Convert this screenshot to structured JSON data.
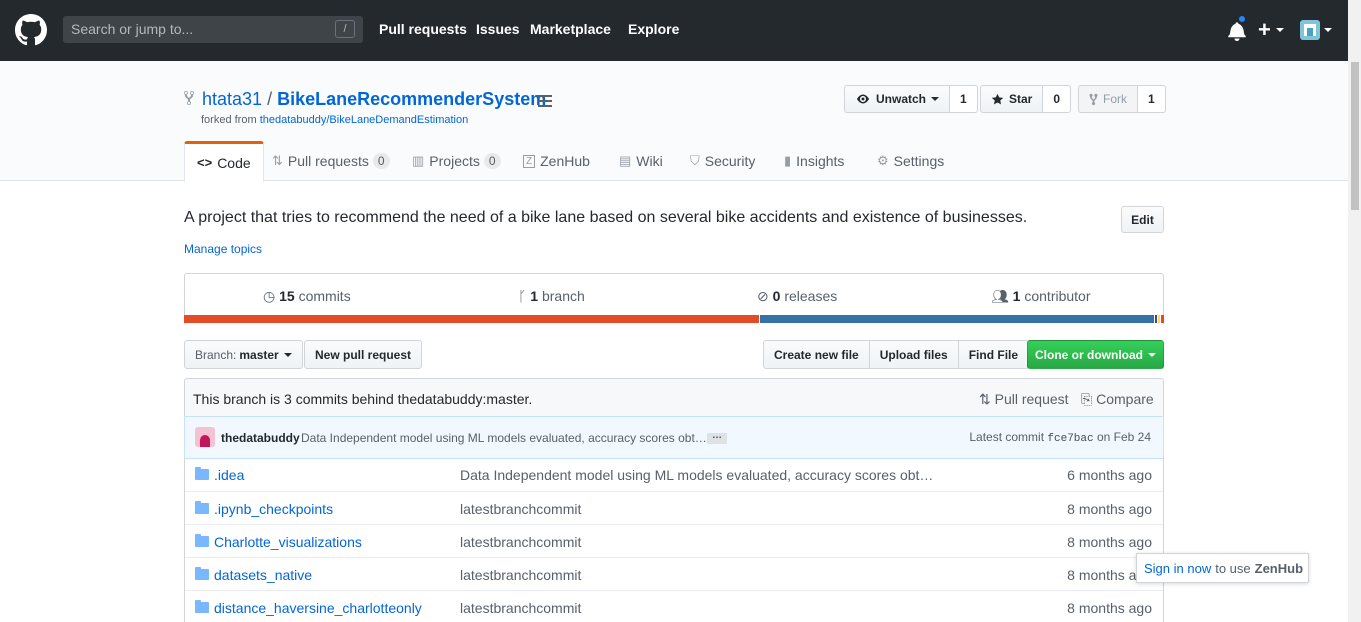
{
  "header": {
    "search_placeholder": "Search or jump to...",
    "search_shortcut": "/",
    "nav": [
      "Pull requests",
      "Issues",
      "Marketplace",
      "Explore"
    ],
    "plus": "+"
  },
  "repo": {
    "owner": "htata31",
    "separator": "/",
    "name": "BikeLaneRecommenderSystem",
    "forked_label": "forked from",
    "forked_from": "thedatabuddy/BikeLaneDemandEstimation",
    "unwatch_label": "Unwatch",
    "watch_count": "1",
    "star_label": "Star",
    "star_count": "0",
    "fork_label": "Fork",
    "fork_count": "1"
  },
  "tabs": {
    "code": "Code",
    "pulls": "Pull requests",
    "pulls_count": "0",
    "projects": "Projects",
    "projects_count": "0",
    "zenhub": "ZenHub",
    "wiki": "Wiki",
    "security": "Security",
    "insights": "Insights",
    "settings": "Settings"
  },
  "description": {
    "text": "A project that tries to recommend the need of a bike lane based on several bike accidents and existence of businesses.",
    "edit": "Edit",
    "manage_topics": "Manage topics"
  },
  "summary": {
    "commits_num": "15",
    "commits_label": "commits",
    "branch_num": "1",
    "branch_label": "branch",
    "releases_num": "0",
    "releases_label": "releases",
    "contributors_num": "1",
    "contributors_label": "contributor"
  },
  "languages": [
    {
      "color": "#e34c26",
      "fraction": 0.589
    },
    {
      "color": "#3572a5",
      "fraction": 0.404
    },
    {
      "color": "#563d7c",
      "fraction": 0.002
    },
    {
      "color": "#f1e05a",
      "fraction": 0.002
    },
    {
      "color": "#e44b23",
      "fraction": 0.003
    }
  ],
  "file_nav": {
    "branch_label": "Branch:",
    "branch_value": "master",
    "new_pr": "New pull request",
    "create_file": "Create new file",
    "upload_files": "Upload files",
    "find_file": "Find File",
    "clone": "Clone or download"
  },
  "branch_info": {
    "text": "This branch is 3 commits behind thedatabuddy:master.",
    "pull_request": "Pull request",
    "compare": "Compare"
  },
  "latest_commit": {
    "author": "thedatabuddy",
    "message": "Data Independent model using ML models evaluated, accuracy scores obt…",
    "ellipsis": "…",
    "label": "Latest commit",
    "sha": "fce7bac",
    "date": "on Feb 24"
  },
  "files": [
    {
      "name": ".idea",
      "message": "Data Independent model using ML models evaluated, accuracy scores obt…",
      "age": "6 months ago"
    },
    {
      "name": ".ipynb_checkpoints",
      "message": "latestbranchcommit",
      "age": "8 months ago"
    },
    {
      "name": "Charlotte_visualizations",
      "message": "latestbranchcommit",
      "age": "8 months ago"
    },
    {
      "name": "datasets_native",
      "message": "latestbranchcommit",
      "age": "8 months ago"
    },
    {
      "name": "distance_haversine_charlotteonly",
      "message": "latestbranchcommit",
      "age": "8 months ago"
    }
  ],
  "zenhub_popup": {
    "link": "Sign in now",
    "text": "to use",
    "brand": "ZenHub"
  },
  "colors": {
    "header_bg": "#24292e",
    "link": "#0366d6",
    "tab_accent": "#e36209",
    "clone_green": "#28a745"
  },
  "icons": [
    "github-logo-icon",
    "bell-icon",
    "plus-icon",
    "repo-forked-icon",
    "eye-icon",
    "star-icon",
    "code-icon",
    "history-icon",
    "git-branch-icon",
    "tag-icon",
    "people-icon",
    "folder-icon"
  ]
}
